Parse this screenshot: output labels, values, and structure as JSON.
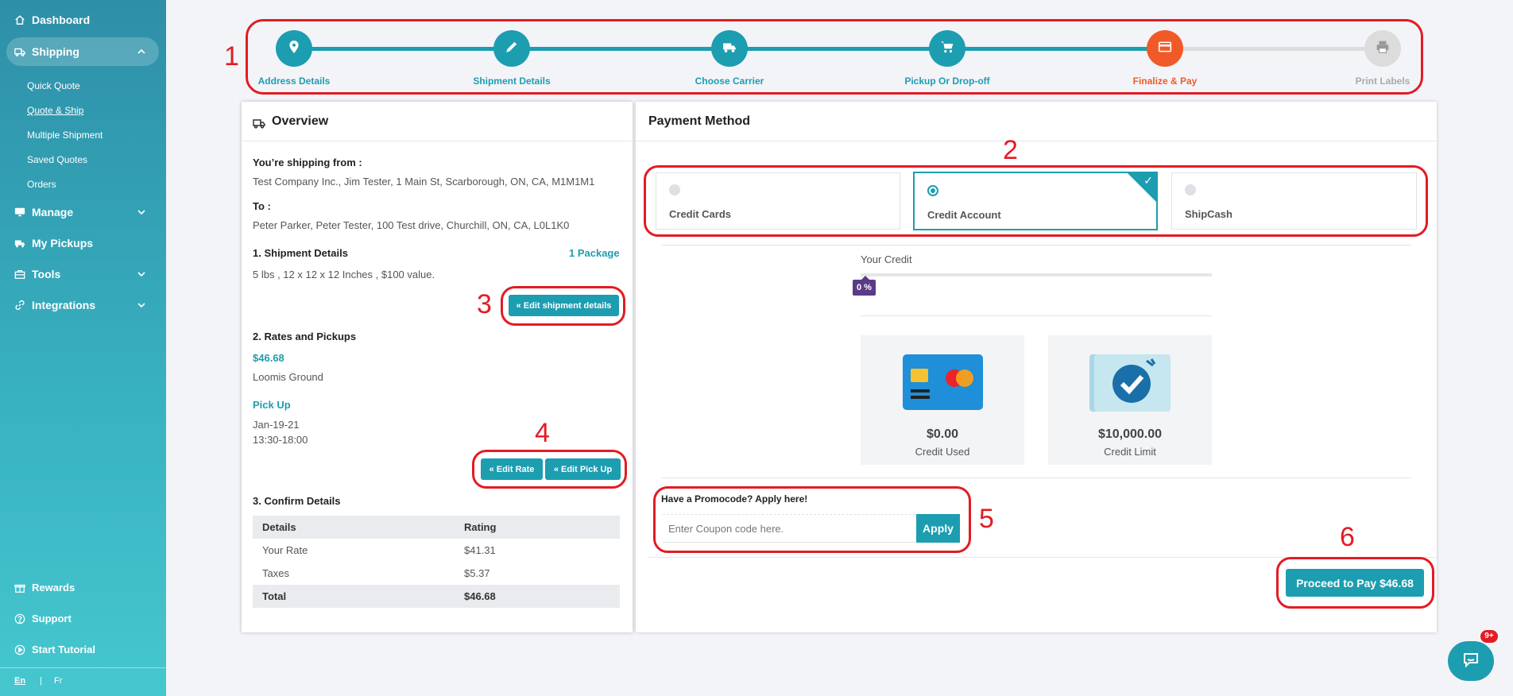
{
  "sidebar": {
    "dashboard": "Dashboard",
    "shipping": "Shipping",
    "sub_items": [
      "Quick Quote",
      "Quote & Ship",
      "Multiple Shipment",
      "Saved Quotes",
      "Orders"
    ],
    "manage": "Manage",
    "my_pickups": "My Pickups",
    "tools": "Tools",
    "integrations": "Integrations",
    "rewards": "Rewards",
    "support": "Support",
    "start_tutorial": "Start Tutorial",
    "lang_en": "En",
    "lang_sep": "|",
    "lang_fr": "Fr"
  },
  "stepper": {
    "steps": [
      {
        "label": "Address Details",
        "icon": "map-pin-icon",
        "state": "done"
      },
      {
        "label": "Shipment Details",
        "icon": "pencil-icon",
        "state": "done"
      },
      {
        "label": "Choose Carrier",
        "icon": "truck-icon",
        "state": "done"
      },
      {
        "label": "Pickup Or Drop-off",
        "icon": "cart-icon",
        "state": "done"
      },
      {
        "label": "Finalize & Pay",
        "icon": "credit-card-icon",
        "state": "current"
      },
      {
        "label": "Print Labels",
        "icon": "printer-icon",
        "state": "pending"
      }
    ]
  },
  "annotations": [
    "1",
    "2",
    "3",
    "4",
    "5",
    "6"
  ],
  "overview": {
    "title": "Overview",
    "from_label": "You’re shipping from :",
    "from_value": "Test Company Inc., Jim Tester, 1 Main St, Scarborough, ON, CA, M1M1M1",
    "to_label": "To :",
    "to_value": "Peter Parker, Peter Tester, 100 Test drive, Churchill, ON, CA, L0L1K0",
    "shipment_heading": "1. Shipment Details",
    "package_count": "1 Package",
    "shipment_value": "5 lbs , 12 x 12 x 12 Inches , $100 value.",
    "edit_shipment": "« Edit shipment details",
    "rates_heading": "2. Rates and Pickups",
    "rate_price": "$46.68",
    "carrier": "Loomis Ground",
    "pickup_label": "Pick Up",
    "pickup_date": "Jan-19-21",
    "pickup_time": "13:30-18:00",
    "edit_rate": "« Edit Rate",
    "edit_pickup": "« Edit Pick Up",
    "confirm_heading": "3. Confirm Details",
    "table": {
      "headers": [
        "Details",
        "Rating"
      ],
      "rows": [
        [
          "Your Rate",
          "$41.31"
        ],
        [
          "Taxes",
          "$5.37"
        ]
      ],
      "total": [
        "Total",
        "$46.68"
      ]
    }
  },
  "payment": {
    "title": "Payment Method",
    "options": [
      {
        "label": "Credit Cards",
        "selected": false
      },
      {
        "label": "Credit Account",
        "selected": true
      },
      {
        "label": "ShipCash",
        "selected": false
      }
    ],
    "check_mark": "✓",
    "your_credit_label": "Your Credit",
    "credit_percent_label": "0 %",
    "credit_progress": 0,
    "credit_used_amount": "$0.00",
    "credit_used_label": "Credit Used",
    "credit_limit_amount": "$10,000.00",
    "credit_limit_label": "Credit Limit",
    "promo_label": "Have a Promocode? Apply here!",
    "coupon_placeholder": "Enter Coupon code here.",
    "apply_label": "Apply",
    "proceed_label": "Proceed to Pay $46.68"
  },
  "chat": {
    "badge": "9+"
  },
  "colors": {
    "teal": "#1d9db0",
    "orange": "#f05a28",
    "annotation_red": "#e31b23",
    "pending_grey": "#dcdcdc"
  }
}
